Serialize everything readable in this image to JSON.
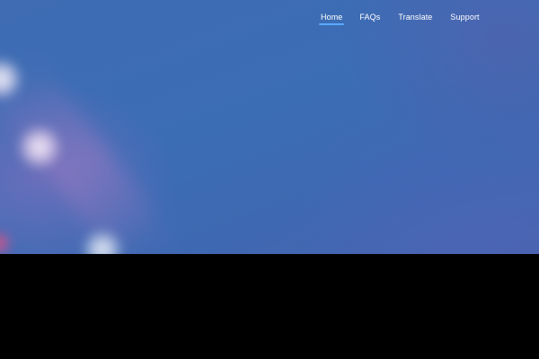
{
  "nav": {
    "items": [
      {
        "label": "Home",
        "active": true
      },
      {
        "label": "FAQs",
        "active": false
      },
      {
        "label": "Translate",
        "active": false
      },
      {
        "label": "Support",
        "active": false
      }
    ],
    "active_underline_color": "#5ba9ff",
    "text_color": "#ffffff"
  },
  "hero": {
    "background_color": "#3d6db4",
    "accent_colors": [
      "#8c6ebe",
      "#f05078",
      "#ffffff"
    ]
  },
  "footer_band": {
    "background_color": "#000000"
  }
}
